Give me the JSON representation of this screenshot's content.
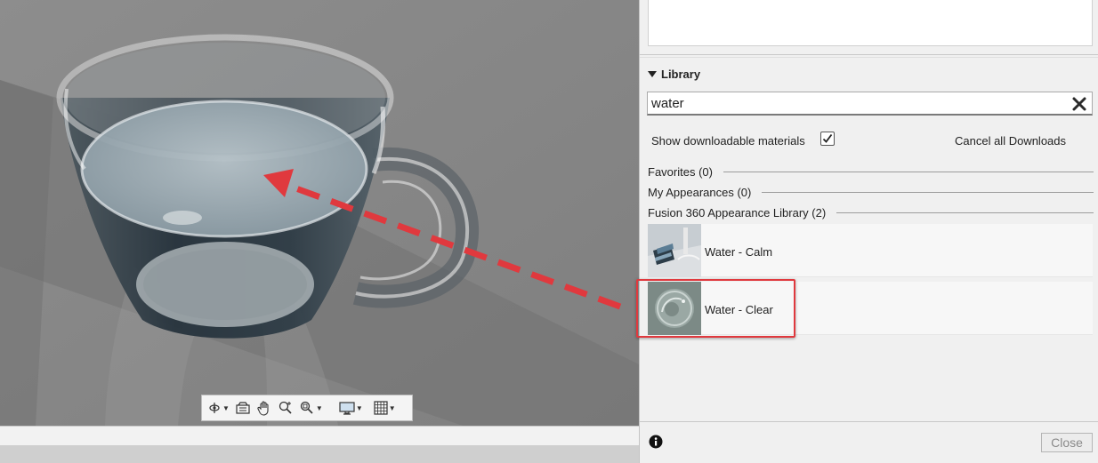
{
  "library": {
    "section_title": "Library",
    "search_value": "water",
    "show_downloadable_label": "Show downloadable materials",
    "show_downloadable_checked": true,
    "cancel_downloads_label": "Cancel all Downloads",
    "groups": [
      {
        "label": "Favorites (0)"
      },
      {
        "label": "My Appearances (0)"
      },
      {
        "label": "Fusion 360 Appearance Library (2)"
      }
    ],
    "items": [
      {
        "name": "Water - Calm",
        "icon": "water-calm-thumbnail"
      },
      {
        "name": "Water - Clear",
        "icon": "water-clear-thumbnail"
      }
    ]
  },
  "footer": {
    "close_label": "Close",
    "info_icon": "info-icon"
  },
  "viewport_toolbar": {
    "tools": [
      "orbit-icon",
      "look-at-icon",
      "pan-icon",
      "zoom-icon",
      "fit-icon",
      "display-settings-icon",
      "grid-icon"
    ]
  },
  "annotation": {
    "color": "#e0393e"
  }
}
